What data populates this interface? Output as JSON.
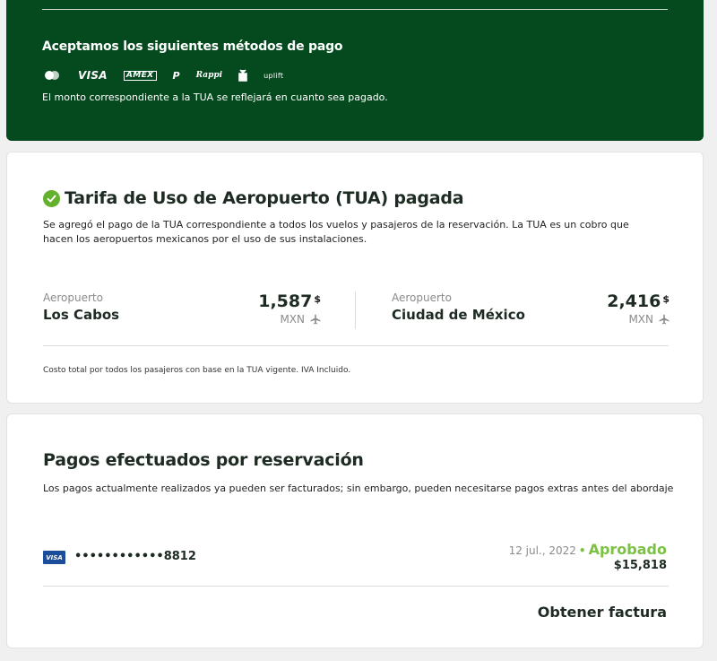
{
  "payment_methods": {
    "title": "Aceptamos los siguientes métodos de pago",
    "icons": [
      {
        "name": "mastercard-icon",
        "label": ""
      },
      {
        "name": "visa-icon",
        "label": "VISA"
      },
      {
        "name": "amex-icon",
        "label": "AMEX"
      },
      {
        "name": "paypal-icon",
        "label": "P"
      },
      {
        "name": "rappi-icon",
        "label": "Rappi"
      },
      {
        "name": "oxxo-icon",
        "label": ""
      },
      {
        "name": "uplift-icon",
        "label": "uplift"
      }
    ],
    "note": "El monto correspondiente a la TUA se reflejará en cuanto sea pagado."
  },
  "tua": {
    "title": "Tarifa de Uso de Aeropuerto (TUA) pagada",
    "description": "Se agregó el pago de la TUA correspondiente a todos los vuelos y pasajeros de la reservación. La TUA es un cobro que hacen los aeropuertos mexicanos por el uso de sus instalaciones.",
    "airports": [
      {
        "label": "Aeropuerto",
        "name": "Los Cabos",
        "amount": "1,587",
        "symbol": "$",
        "currency": "MXN"
      },
      {
        "label": "Aeropuerto",
        "name": "Ciudad de México",
        "amount": "2,416",
        "symbol": "$",
        "currency": "MXN"
      }
    ],
    "footnote": "Costo total por todos los pasajeros con base en la TUA vigente. IVA Incluido."
  },
  "payments": {
    "title": "Pagos efectuados por reservación",
    "description": "Los pagos actualmente realizados ya pueden ser facturados; sin embargo, pueden necesitarse pagos extras antes del abordaje",
    "card_brand": "VISA",
    "card_number": "••••••••••••8812",
    "date": "12 jul., 2022",
    "status": "Aprobado",
    "amount": "$15,818",
    "invoice_label": "Obtener factura"
  },
  "colors": {
    "green_dark": "#054a1f",
    "check_green": "#63b12c",
    "status_green": "#7cc242",
    "visa_blue": "#1a4e9a"
  }
}
